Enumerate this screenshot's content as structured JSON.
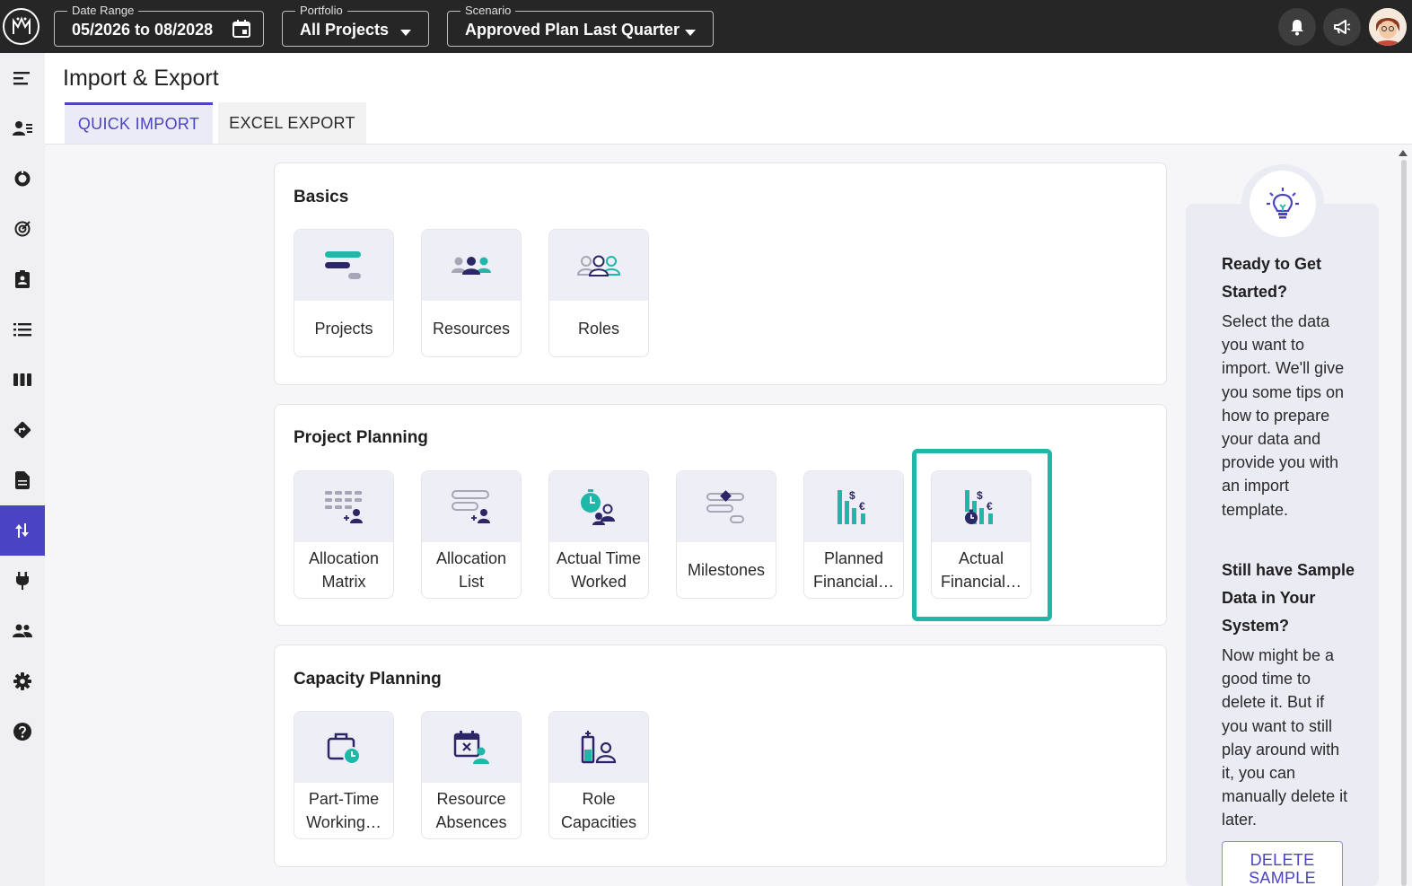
{
  "topbar": {
    "date_range": {
      "label": "Date Range",
      "value": "05/2026 to 08/2028"
    },
    "portfolio": {
      "label": "Portfolio",
      "value": "All Projects"
    },
    "scenario": {
      "label": "Scenario",
      "value": "Approved Plan Last Quarter"
    },
    "icons": [
      "calendar-icon",
      "bell-icon",
      "megaphone-icon"
    ]
  },
  "page": {
    "title": "Import & Export",
    "tabs": [
      {
        "label": "QUICK IMPORT",
        "active": true
      },
      {
        "label": "EXCEL EXPORT",
        "active": false
      }
    ]
  },
  "sections": [
    {
      "title": "Basics",
      "tiles": [
        {
          "label": "Projects",
          "icon": "projects-icon"
        },
        {
          "label": "Resources",
          "icon": "resources-icon"
        },
        {
          "label": "Roles",
          "icon": "roles-icon"
        }
      ]
    },
    {
      "title": "Project Planning",
      "tiles": [
        {
          "label": "Allocation Matrix",
          "icon": "allocation-matrix-icon"
        },
        {
          "label": "Allocation List",
          "icon": "allocation-list-icon"
        },
        {
          "label": "Actual Time Worked",
          "icon": "actual-time-worked-icon"
        },
        {
          "label": "Milestones",
          "icon": "milestones-icon"
        },
        {
          "label": "Planned Financial…",
          "icon": "planned-financials-icon"
        },
        {
          "label": "Actual Financial…",
          "icon": "actual-financials-icon",
          "selected": true
        }
      ]
    },
    {
      "title": "Capacity Planning",
      "tiles": [
        {
          "label": "Part-Time Working…",
          "icon": "part-time-working-icon"
        },
        {
          "label": "Resource Absences",
          "icon": "resource-absences-icon"
        },
        {
          "label": "Role Capacities",
          "icon": "role-capacities-icon"
        }
      ]
    }
  ],
  "help": {
    "heading1": "Ready to Get Started?",
    "text1": "Select the data you want to import. We'll give you some tips on how to prepare your data and provide you with an import template.",
    "heading2": "Still have Sample Data in Your System?",
    "text2": "Now might be a good time to delete it. But if you want to still play around with it, you can manually delete it later.",
    "button": "DELETE SAMPLE"
  },
  "colors": {
    "accent": "#4b44c2",
    "teal": "#1fb8a8",
    "navy": "#2b2766",
    "topbar": "#262626"
  }
}
